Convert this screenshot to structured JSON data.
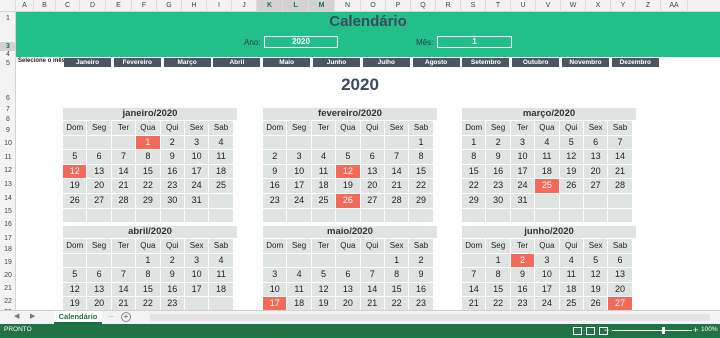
{
  "sheet": {
    "columns": [
      "A",
      "B",
      "C",
      "D",
      "E",
      "F",
      "G",
      "H",
      "I",
      "J",
      "K",
      "L",
      "M",
      "N",
      "O",
      "P",
      "Q",
      "R",
      "S",
      "T",
      "U",
      "V",
      "W",
      "X",
      "Y",
      "Z",
      "AA"
    ],
    "rows": [
      "1",
      "3",
      "4",
      "5",
      "6",
      "7",
      "8",
      "9",
      "10",
      "11",
      "12",
      "13",
      "14",
      "15",
      "16",
      "17",
      "18",
      "19",
      "20",
      "21",
      "22",
      "23"
    ]
  },
  "banner": {
    "title": "Calendário",
    "ano_label": "Ano:",
    "ano_value": "2020",
    "mes_label": "Mês:",
    "mes_value": "1"
  },
  "month_selector": {
    "label": "Selecione o mês:",
    "months": [
      "Janeiro",
      "Fevereiro",
      "Março",
      "Abril",
      "Maio",
      "Junho",
      "Julho",
      "Agosto",
      "Setembro",
      "Outubro",
      "Novembro",
      "Dezembro"
    ]
  },
  "year_heading": "2020",
  "weekdays": [
    "Dom",
    "Seg",
    "Ter",
    "Qua",
    "Qui",
    "Sex",
    "Sab"
  ],
  "calendars": [
    {
      "title": "janeiro/2020",
      "start": 3,
      "days": 31,
      "rows": 6,
      "highlight": [
        1,
        12
      ]
    },
    {
      "title": "fevereiro/2020",
      "start": 6,
      "days": 29,
      "rows": 6,
      "highlight": [
        12,
        26
      ]
    },
    {
      "title": "março/2020",
      "start": 0,
      "days": 31,
      "rows": 6,
      "highlight": [
        25
      ]
    },
    {
      "title": "abril/2020",
      "start": 3,
      "days": 23,
      "rows": 4,
      "highlight": []
    },
    {
      "title": "maio/2020",
      "start": 5,
      "days": 23,
      "rows": 4,
      "highlight": [
        17
      ]
    },
    {
      "title": "junho/2020",
      "start": 1,
      "days": 27,
      "rows": 4,
      "highlight": [
        2,
        27
      ]
    }
  ],
  "tabs": {
    "active": "Calendário",
    "more": "...",
    "add": "+"
  },
  "status": {
    "text": "PRONTO",
    "zoom": "100%"
  }
}
